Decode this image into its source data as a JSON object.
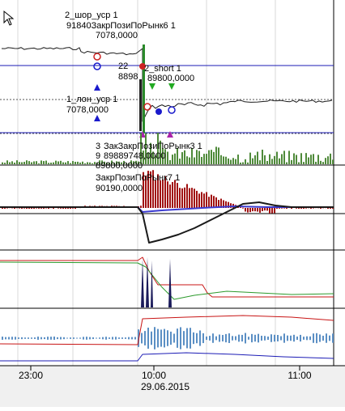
{
  "colors": {
    "background": "#ffffff",
    "frame": "#000000",
    "grid": "#d8d8d8",
    "price": "#1a1a1a",
    "level_line": "#1b1bb5",
    "dashed_line": "#555555",
    "volume": "#4f8a3a",
    "macd_hist": "#a01010",
    "macd_line": "#1a1a1a",
    "signal_line": "#3a3acf",
    "osc_red": "#c81414",
    "osc_green": "#2c9a2c",
    "osc_fill": "#1a1a5a",
    "bottom_bars": "#5b8fc4",
    "bottom_red": "#c81414",
    "bottom_blue": "#1b1bb5",
    "axis_bg": "#f0f0f0",
    "sell_marker": "#cc2222",
    "buy_marker": "#1a1acc",
    "trade_green": "#22aa22",
    "trade_magenta": "#aa22aa"
  },
  "chart_data": [
    {
      "panel": "price",
      "type": "line",
      "x_ticks": [
        "23:00",
        "10:00",
        "11:00"
      ],
      "x_date": "29.06.2015",
      "labels": [
        {
          "text": "2_шор_уср 1",
          "role": "trade"
        },
        {
          "text": "91840ЗакрПозиПоРынк6 1",
          "role": "trade"
        },
        {
          "text": "7078,0000",
          "role": "price"
        },
        {
          "text": "22",
          "role": "trade"
        },
        {
          "text": "8898",
          "role": "price"
        },
        {
          "text": "2_short 1",
          "role": "trade"
        },
        {
          "text": "89800,0000",
          "role": "price"
        },
        {
          "text": "1_лон_уср 1",
          "role": "trade"
        },
        {
          "text": "7078,0000",
          "role": "price"
        }
      ]
    },
    {
      "panel": "volume",
      "type": "bar",
      "labels": [
        {
          "text": "3",
          "role": "trade"
        },
        {
          "text": "ЗакЗакрПозиПоРынк3 1",
          "role": "trade"
        },
        {
          "text": "9",
          "role": "price"
        },
        {
          "text": "89889748,0000",
          "role": "price"
        },
        {
          "text": "89800,0000",
          "role": "price"
        },
        {
          "text": "ЗакрПозиПоРынк7 1",
          "role": "trade"
        },
        {
          "text": "90190,0000",
          "role": "price"
        }
      ]
    },
    {
      "panel": "macd",
      "type": "bar",
      "series": [
        "histogram",
        "macd",
        "signal"
      ]
    },
    {
      "panel": "oscillator",
      "type": "line",
      "series": [
        "red",
        "green",
        "fill"
      ]
    },
    {
      "panel": "indicator",
      "type": "bar",
      "series": [
        "bars",
        "red",
        "blue"
      ]
    }
  ]
}
